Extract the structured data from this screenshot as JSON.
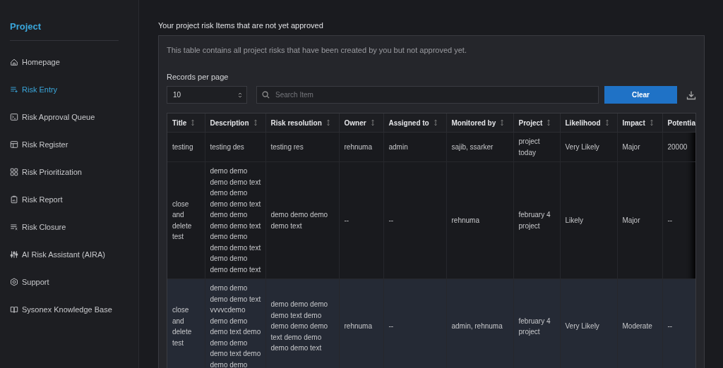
{
  "sidebar": {
    "title": "Project",
    "items": [
      {
        "label": "Homepage",
        "selected": false
      },
      {
        "label": "Risk Entry",
        "selected": true
      },
      {
        "label": "Risk Approval Queue",
        "selected": false
      },
      {
        "label": "Risk Register",
        "selected": false
      },
      {
        "label": "Risk Prioritization",
        "selected": false
      },
      {
        "label": "Risk Report",
        "selected": false
      },
      {
        "label": "Risk Closure",
        "selected": false
      },
      {
        "label": "AI Risk Assistant (AIRA)",
        "selected": false
      },
      {
        "label": "Support",
        "selected": false
      },
      {
        "label": "Sysonex Knowledge Base",
        "selected": false
      }
    ]
  },
  "page_title": "Your project risk Items that are not yet approved",
  "panel": {
    "description": "This table contains all project risks that have been created by you but not approved yet.",
    "records_label": "Records per page",
    "records_value": "10",
    "search": {
      "placeholder": "Search Item"
    },
    "clear_button": "Clear"
  },
  "table": {
    "columns": [
      "Title",
      "Description",
      "Risk resolution",
      "Owner",
      "Assigned to",
      "Monitored by",
      "Project",
      "Likelihood",
      "Impact",
      "Potentia"
    ],
    "rows": [
      {
        "selected": false,
        "cells": [
          "testing",
          "testing des",
          "testing res",
          "rehnuma",
          "admin",
          "sajib, ssarker",
          "project today",
          "Very Likely",
          "Major",
          "20000"
        ]
      },
      {
        "selected": false,
        "cells": [
          "close and delete test",
          "demo demo demo demo text demo demo demo demo text demo demo demo demo text demo demo demo demo text demo demo demo demo text",
          "demo demo demo demo text",
          "--",
          "--",
          "rehnuma",
          "february 4 project",
          "Likely",
          "Major",
          "--"
        ]
      },
      {
        "selected": true,
        "cells": [
          "close and delete test",
          "demo demo demo demo text vvvvcdemo demo demo demo text demo demo demo demo text demo demo demo",
          "demo demo demo demo text demo demo demo demo text demo demo demo demo text",
          "rehnuma",
          "--",
          "admin, rehnuma",
          "february 4 project",
          "Very Likely",
          "Moderate",
          "--"
        ]
      }
    ]
  }
}
